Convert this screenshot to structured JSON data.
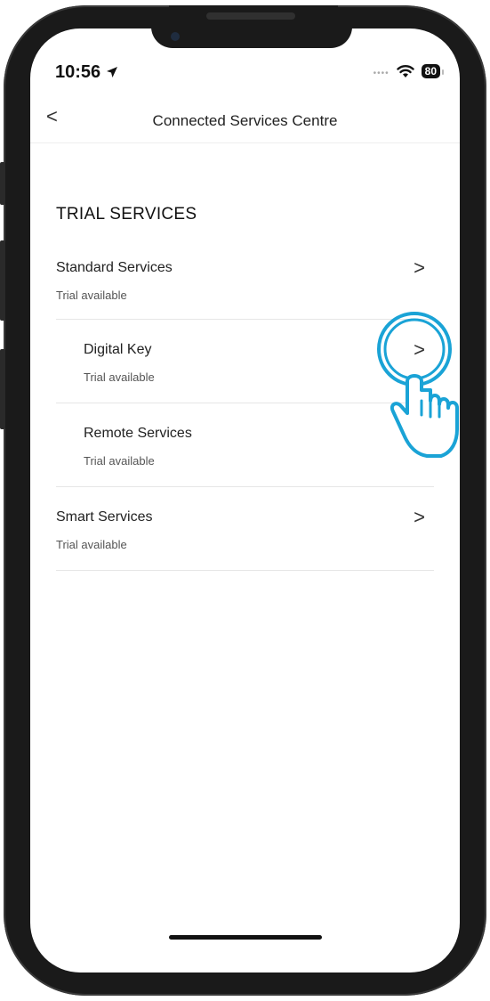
{
  "status_bar": {
    "time": "10:56",
    "battery": "80"
  },
  "header": {
    "title": "Connected Services Centre",
    "back_label": "<"
  },
  "section": {
    "title": "TRIAL SERVICES"
  },
  "rows": [
    {
      "name": "Standard Services",
      "sub": "Trial available",
      "chevron": ">"
    },
    {
      "name": "Digital Key",
      "sub": "Trial available",
      "chevron": ">"
    },
    {
      "name": "Remote Services",
      "sub": "Trial available",
      "chevron": ""
    },
    {
      "name": "Smart Services",
      "sub": "Trial available",
      "chevron": ">"
    }
  ],
  "colors": {
    "tap_highlight": "#1aa3d6",
    "divider": "#e6e6e6"
  },
  "icons": {
    "status_location": "location-arrow-icon",
    "status_wifi": "wifi-icon",
    "tap_hand": "hand-pointer-icon"
  }
}
